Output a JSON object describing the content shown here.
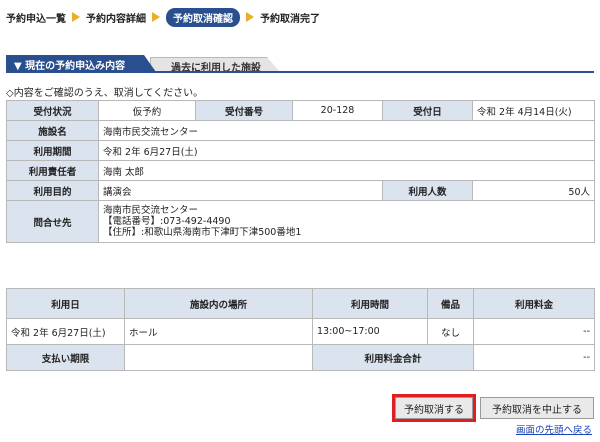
{
  "breadcrumb": {
    "step1": "予約申込一覧",
    "step2": "予約内容詳細",
    "step3": "予約取消確認",
    "step4": "予約取消完了"
  },
  "tabs": {
    "current": "▼ 現在の予約申込み内容",
    "past": "過去に利用した施設"
  },
  "confirm_message": "◇内容をご確認のうえ、取消してください。",
  "details": {
    "status_label": "受付状況",
    "status_value": "仮予約",
    "number_label": "受付番号",
    "number_value": "20-128",
    "date_label": "受付日",
    "date_value": "令和 2年 4月14日(火)",
    "facility_label": "施設名",
    "facility_value": "海南市民交流センター",
    "period_label": "利用期間",
    "period_value": "令和 2年 6月27日(土)",
    "responsible_label": "利用責任者",
    "responsible_value": "海南 太郎",
    "purpose_label": "利用目的",
    "purpose_value": "講演会",
    "people_label": "利用人数",
    "people_value": "50人",
    "contact_label": "問合せ先",
    "contact_line1": "海南市民交流センター",
    "contact_line2": "【電話番号】:073-492-4490",
    "contact_line3": "【住所】:和歌山県海南市下津町下津500番地1"
  },
  "usage": {
    "headers": {
      "date": "利用日",
      "place": "施設内の場所",
      "time": "利用時間",
      "equipment": "備品",
      "fee": "利用料金"
    },
    "row": {
      "date": "令和 2年 6月27日(土)",
      "place": "ホール",
      "time": "13:00~17:00",
      "equipment": "なし",
      "fee": "--"
    },
    "deadline_label": "支払い期限",
    "deadline_value": "",
    "total_label": "利用料金合計",
    "total_value": "--"
  },
  "buttons": {
    "cancel_reservation": "予約取消する",
    "stop_cancel": "予約取消を中止する"
  },
  "links": {
    "back_to_top": "画面の先頭へ戻る"
  },
  "colors": {
    "accent": "#2a4f8e",
    "arrow": "#e8b024",
    "label_bg": "#dbe3ee",
    "highlight": "#e02020",
    "link": "#1a44b8"
  }
}
